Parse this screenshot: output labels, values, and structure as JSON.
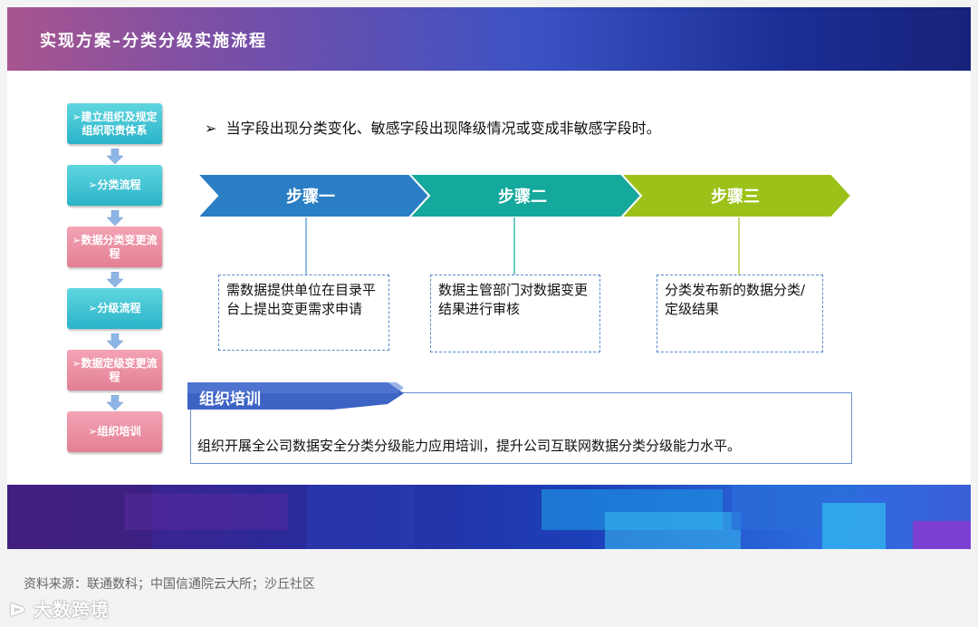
{
  "header": {
    "title": "实现方案–分类分级实施流程"
  },
  "sidebar": {
    "items": [
      {
        "label": "➢建立组织及规定组织职责体系",
        "color": "teal"
      },
      {
        "label": "➢分类流程",
        "color": "teal"
      },
      {
        "label": "➢数据分类变更流程",
        "color": "pink"
      },
      {
        "label": "➢分级流程",
        "color": "teal"
      },
      {
        "label": "➢数据定级变更流程",
        "color": "pink"
      },
      {
        "label": "➢组织培训",
        "color": "pink"
      }
    ]
  },
  "main": {
    "headline": "当字段出现分类变化、敏感字段出现降级情况或变成非敏感字段时。",
    "steps": [
      {
        "label": "步骤一",
        "color": "#2a7fc4",
        "desc": "需数据提供单位在目录平台上提出变更需求申请"
      },
      {
        "label": "步骤二",
        "color": "#15a89c",
        "desc": "数据主管部门对数据变更结果进行审核"
      },
      {
        "label": "步骤三",
        "color": "#9cc21a",
        "desc": "分类发布新的数据分类/定级结果"
      }
    ]
  },
  "training": {
    "title": "组织培训",
    "text": "组织开展全公司数据安全分类分级能力应用培训，提升公司互联网数据分类分级能力水平。"
  },
  "footer": {
    "source": "资料来源：联通数科；中国信通院云大所；沙丘社区",
    "logo": "大数跨境"
  }
}
